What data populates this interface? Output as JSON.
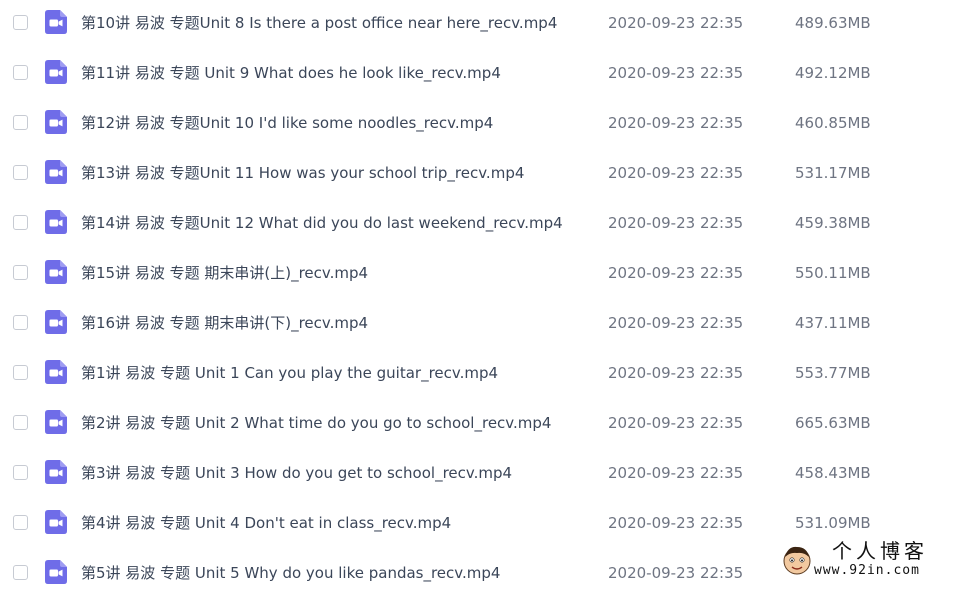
{
  "file_list": {
    "icon": "video-file-icon",
    "icon_color": "#6f6ce8",
    "rows": [
      {
        "name": "第10讲 易波 专题Unit 8 Is there a post office near here_recv.mp4",
        "date": "2020-09-23 22:35",
        "size": "489.63MB"
      },
      {
        "name": "第11讲 易波 专题 Unit 9 What does he look like_recv.mp4",
        "date": "2020-09-23 22:35",
        "size": "492.12MB"
      },
      {
        "name": "第12讲 易波 专题Unit 10 I'd like some noodles_recv.mp4",
        "date": "2020-09-23 22:35",
        "size": "460.85MB"
      },
      {
        "name": "第13讲 易波 专题Unit 11 How was your school trip_recv.mp4",
        "date": "2020-09-23 22:35",
        "size": "531.17MB"
      },
      {
        "name": "第14讲 易波 专题Unit 12 What did you do last weekend_recv.mp4",
        "date": "2020-09-23 22:35",
        "size": "459.38MB"
      },
      {
        "name": "第15讲 易波 专题 期末串讲(上)_recv.mp4",
        "date": "2020-09-23 22:35",
        "size": "550.11MB"
      },
      {
        "name": "第16讲 易波 专题 期末串讲(下)_recv.mp4",
        "date": "2020-09-23 22:35",
        "size": "437.11MB"
      },
      {
        "name": "第1讲 易波 专题 Unit 1 Can you play the guitar_recv.mp4",
        "date": "2020-09-23 22:35",
        "size": "553.77MB"
      },
      {
        "name": "第2讲 易波 专题 Unit 2 What time do you go to school_recv.mp4",
        "date": "2020-09-23 22:35",
        "size": "665.63MB"
      },
      {
        "name": "第3讲 易波 专题 Unit 3 How do you get to school_recv.mp4",
        "date": "2020-09-23 22:35",
        "size": "458.43MB"
      },
      {
        "name": "第4讲 易波 专题 Unit 4 Don't eat in class_recv.mp4",
        "date": "2020-09-23 22:35",
        "size": "531.09MB"
      },
      {
        "name": "第5讲 易波 专题 Unit 5 Why do you like pandas_recv.mp4",
        "date": "2020-09-23 22:35",
        "size": ""
      }
    ]
  },
  "watermark": {
    "title": "个人博客",
    "url": "www.92in.com"
  }
}
